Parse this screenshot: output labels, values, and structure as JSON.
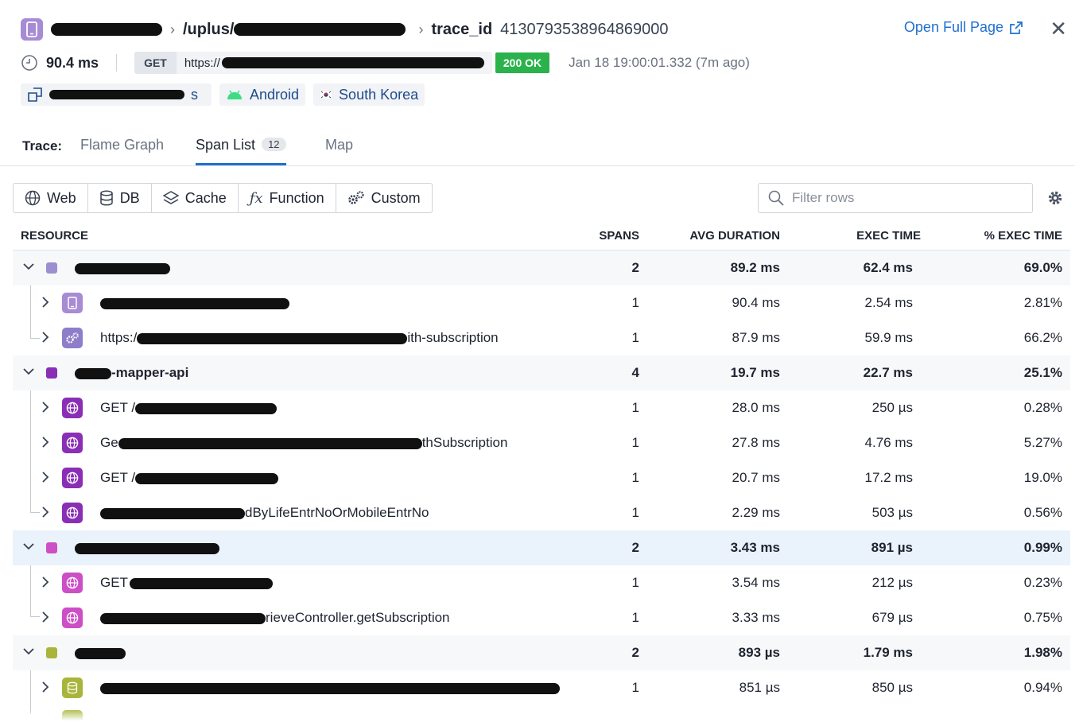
{
  "header": {
    "service_name": "",
    "resource_path": "/uplus/",
    "trace_label": "trace_id",
    "trace_id": "4130793538964869000",
    "open_full_page": "Open Full Page",
    "duration": "90.4 ms",
    "method": "GET",
    "url": "https://",
    "status": "200 OK",
    "time": "Jan 18 19:00:01.332 (7m ago)",
    "chips": {
      "env_tail": "s",
      "platform": "Android",
      "country": "South Korea"
    }
  },
  "tabs": {
    "label": "Trace:",
    "items": [
      {
        "label": "Flame Graph"
      },
      {
        "label": "Span List",
        "count": "12"
      },
      {
        "label": "Map"
      }
    ],
    "active": "Span List"
  },
  "filters": {
    "types": [
      {
        "label": "Web",
        "icon": "globe-icon"
      },
      {
        "label": "DB",
        "icon": "database-icon"
      },
      {
        "label": "Cache",
        "icon": "layers-icon"
      },
      {
        "label": "Function",
        "icon": "fx-icon"
      },
      {
        "label": "Custom",
        "icon": "gears-icon"
      }
    ],
    "search_placeholder": "Filter rows"
  },
  "table": {
    "columns": [
      "RESOURCE",
      "SPANS",
      "AVG DURATION",
      "EXEC TIME",
      "% EXEC TIME"
    ],
    "rows": [
      {
        "kind": "group",
        "color": "#9b8fd1",
        "name": "",
        "spans": "2",
        "avg": "89.2 ms",
        "exec": "62.4 ms",
        "pct": "69.0%"
      },
      {
        "kind": "child",
        "icon": "mobile-icon",
        "icon_color": "#a78bd4",
        "name": "",
        "spans": "1",
        "avg": "90.4 ms",
        "exec": "2.54 ms",
        "pct": "2.81%"
      },
      {
        "kind": "child",
        "icon": "gears-icon",
        "icon_color": "#8e7ec9",
        "name_prefix": "https:/",
        "name": "ith-subscription",
        "spans": "1",
        "avg": "87.9 ms",
        "exec": "59.9 ms",
        "pct": "66.2%"
      },
      {
        "kind": "group",
        "color": "#8a2fb5",
        "name": "-mapper-api",
        "spans": "4",
        "avg": "19.7 ms",
        "exec": "22.7 ms",
        "pct": "25.1%"
      },
      {
        "kind": "child",
        "icon": "globe-icon",
        "icon_color": "#8a2fb5",
        "name_prefix": "GET /",
        "name": "",
        "spans": "1",
        "avg": "28.0 ms",
        "exec": "250 µs",
        "pct": "0.28%"
      },
      {
        "kind": "child",
        "icon": "globe-icon",
        "icon_color": "#8a2fb5",
        "name_prefix": "Ge",
        "name": "thSubscription",
        "spans": "1",
        "avg": "27.8 ms",
        "exec": "4.76 ms",
        "pct": "5.27%"
      },
      {
        "kind": "child",
        "icon": "globe-icon",
        "icon_color": "#8a2fb5",
        "name_prefix": "GET /",
        "name": "",
        "spans": "1",
        "avg": "20.7 ms",
        "exec": "17.2 ms",
        "pct": "19.0%"
      },
      {
        "kind": "child",
        "icon": "globe-icon",
        "icon_color": "#8a2fb5",
        "name": "dByLifeEntrNoOrMobileEntrNo",
        "spans": "1",
        "avg": "2.29 ms",
        "exec": "503 µs",
        "pct": "0.56%"
      },
      {
        "kind": "group",
        "color": "#cc4fc6",
        "name": "",
        "spans": "2",
        "avg": "3.43 ms",
        "exec": "891 µs",
        "pct": "0.99%",
        "selected": true
      },
      {
        "kind": "child",
        "icon": "globe-icon",
        "icon_color": "#cc4fc6",
        "name_prefix": "GET",
        "name": "",
        "spans": "1",
        "avg": "3.54 ms",
        "exec": "212 µs",
        "pct": "0.23%"
      },
      {
        "kind": "child",
        "icon": "globe-icon",
        "icon_color": "#cc4fc6",
        "name": "rieveController.getSubscription",
        "spans": "1",
        "avg": "3.33 ms",
        "exec": "679 µs",
        "pct": "0.75%"
      },
      {
        "kind": "group",
        "color": "#a8b53a",
        "name": "",
        "spans": "2",
        "avg": "893 µs",
        "exec": "1.79 ms",
        "pct": "1.98%"
      },
      {
        "kind": "child",
        "icon": "database-icon",
        "icon_color": "#a8b53a",
        "name": "",
        "spans": "1",
        "avg": "851 µs",
        "exec": "850 µs",
        "pct": "0.94%"
      }
    ]
  }
}
